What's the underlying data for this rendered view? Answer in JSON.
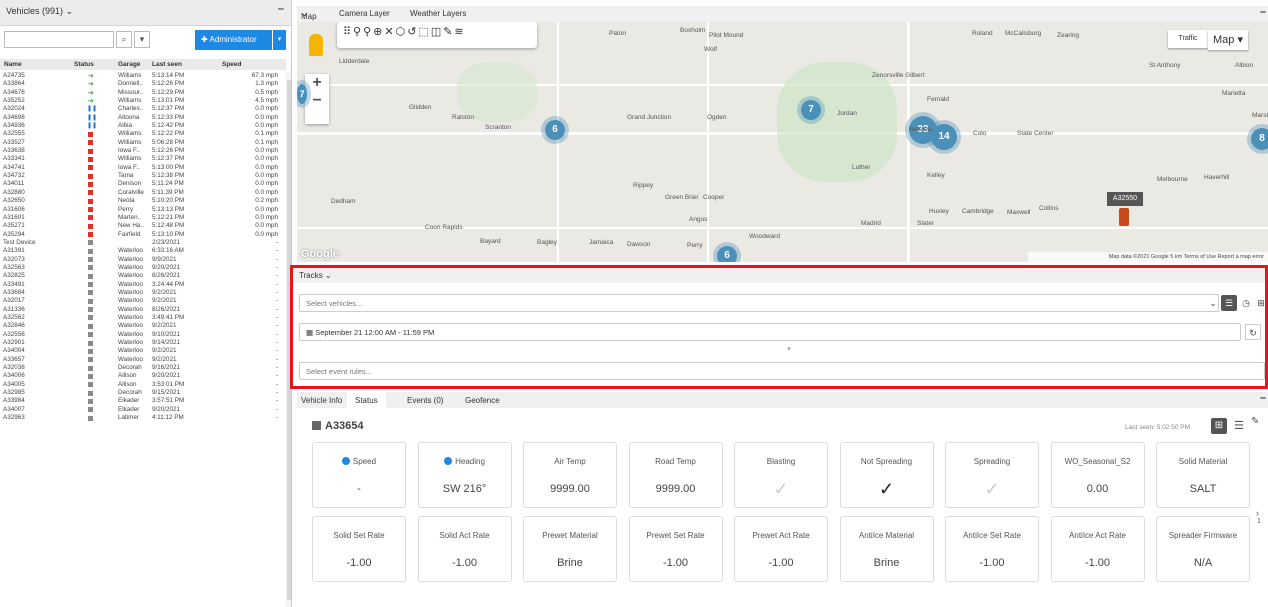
{
  "left_panel": {
    "title": "Vehicles (991)",
    "search_placeholder": "",
    "admin_label": "Administrator",
    "columns": [
      "Name",
      "Status",
      "Garage",
      "Last seen",
      "Speed"
    ],
    "rows": [
      {
        "name": "A24735",
        "status": "green",
        "garage": "Williams",
        "last_seen": "5:13:14 PM",
        "speed": "67.3 mph"
      },
      {
        "name": "A33864",
        "status": "green",
        "garage": "Donnell..",
        "last_seen": "5:12:26 PM",
        "speed": "1.3 mph"
      },
      {
        "name": "A34676",
        "status": "green",
        "garage": "Missour..",
        "last_seen": "5:12:29 PM",
        "speed": "0.5 mph"
      },
      {
        "name": "A35252",
        "status": "green",
        "garage": "Williams",
        "last_seen": "5:13:01 PM",
        "speed": "4.5 mph"
      },
      {
        "name": "A32024",
        "status": "blue",
        "garage": "Charles..",
        "last_seen": "5:12:37 PM",
        "speed": "0.0 mph"
      },
      {
        "name": "A34698",
        "status": "blue",
        "garage": "Altoona",
        "last_seen": "5:12:33 PM",
        "speed": "0.0 mph"
      },
      {
        "name": "A34936",
        "status": "blue",
        "garage": "Albia",
        "last_seen": "5:12:42 PM",
        "speed": "0.0 mph"
      },
      {
        "name": "A32555",
        "status": "red",
        "garage": "Williams",
        "last_seen": "5:12:22 PM",
        "speed": "0.1 mph"
      },
      {
        "name": "A33527",
        "status": "red",
        "garage": "Williams",
        "last_seen": "5:06:28 PM",
        "speed": "0.1 mph"
      },
      {
        "name": "A33638",
        "status": "red",
        "garage": "Iowa F..",
        "last_seen": "5:12:26 PM",
        "speed": "0.0 mph"
      },
      {
        "name": "A33341",
        "status": "red",
        "garage": "Williams",
        "last_seen": "5:12:37 PM",
        "speed": "0.0 mph"
      },
      {
        "name": "A34741",
        "status": "red",
        "garage": "Iowa F..",
        "last_seen": "5:13:00 PM",
        "speed": "0.0 mph"
      },
      {
        "name": "A34732",
        "status": "red",
        "garage": "Tama",
        "last_seen": "5:12:38 PM",
        "speed": "0.0 mph"
      },
      {
        "name": "A34011",
        "status": "red",
        "garage": "Denison",
        "last_seen": "5:11:24 PM",
        "speed": "0.0 mph"
      },
      {
        "name": "A32880",
        "status": "red",
        "garage": "Coralville",
        "last_seen": "5:11:39 PM",
        "speed": "0.0 mph"
      },
      {
        "name": "A32650",
        "status": "red",
        "garage": "Neola",
        "last_seen": "5:10:20 PM",
        "speed": "0.2 mph"
      },
      {
        "name": "A31606",
        "status": "red",
        "garage": "Perry",
        "last_seen": "5:13:13 PM",
        "speed": "0.0 mph"
      },
      {
        "name": "A31601",
        "status": "red",
        "garage": "Marten..",
        "last_seen": "5:12:21 PM",
        "speed": "0.0 mph"
      },
      {
        "name": "A35271",
        "status": "red",
        "garage": "New Ha..",
        "last_seen": "5:12:48 PM",
        "speed": "0.0 mph"
      },
      {
        "name": "A35294",
        "status": "red",
        "garage": "Fairfield",
        "last_seen": "5:13:10 PM",
        "speed": "0.0 mph"
      },
      {
        "name": "Test Device",
        "status": "gray",
        "garage": "",
        "last_seen": "2/23/2021",
        "speed": "-"
      },
      {
        "name": "A31391",
        "status": "gray",
        "garage": "Waterloo",
        "last_seen": "6:33:16 AM",
        "speed": "-"
      },
      {
        "name": "A32073",
        "status": "gray",
        "garage": "Waterloo",
        "last_seen": "9/9/2021",
        "speed": "-"
      },
      {
        "name": "A32563",
        "status": "gray",
        "garage": "Waterloo",
        "last_seen": "9/20/2021",
        "speed": "-"
      },
      {
        "name": "A32825",
        "status": "gray",
        "garage": "Waterloo",
        "last_seen": "8/26/2021",
        "speed": "-"
      },
      {
        "name": "A33491",
        "status": "gray",
        "garage": "Waterloo",
        "last_seen": "3:24:44 PM",
        "speed": "-"
      },
      {
        "name": "A33684",
        "status": "gray",
        "garage": "Waterloo",
        "last_seen": "9/2/2021",
        "speed": "-"
      },
      {
        "name": "A32017",
        "status": "gray",
        "garage": "Waterloo",
        "last_seen": "9/2/2021",
        "speed": "-"
      },
      {
        "name": "A31336",
        "status": "gray",
        "garage": "Waterloo",
        "last_seen": "8/26/2021",
        "speed": "-"
      },
      {
        "name": "A32562",
        "status": "gray",
        "garage": "Waterloo",
        "last_seen": "3:49:41 PM",
        "speed": "-"
      },
      {
        "name": "A32846",
        "status": "gray",
        "garage": "Waterloo",
        "last_seen": "9/2/2021",
        "speed": "-"
      },
      {
        "name": "A32556",
        "status": "gray",
        "garage": "Waterloo",
        "last_seen": "9/10/2021",
        "speed": "-"
      },
      {
        "name": "A32901",
        "status": "gray",
        "garage": "Waterloo",
        "last_seen": "9/14/2021",
        "speed": "-"
      },
      {
        "name": "A34004",
        "status": "gray",
        "garage": "Waterloo",
        "last_seen": "9/2/2021",
        "speed": "-"
      },
      {
        "name": "A33657",
        "status": "gray",
        "garage": "Waterloo",
        "last_seen": "9/2/2021",
        "speed": "-"
      },
      {
        "name": "A32038",
        "status": "gray",
        "garage": "Decorah",
        "last_seen": "9/16/2021",
        "speed": "-"
      },
      {
        "name": "A34006",
        "status": "gray",
        "garage": "Allison",
        "last_seen": "9/20/2021",
        "speed": "-"
      },
      {
        "name": "A34005",
        "status": "gray",
        "garage": "Allison",
        "last_seen": "3:53:01 PM",
        "speed": "-"
      },
      {
        "name": "A32985",
        "status": "gray",
        "garage": "Decorah",
        "last_seen": "9/15/2021",
        "speed": "-"
      },
      {
        "name": "A33984",
        "status": "gray",
        "garage": "Elkader",
        "last_seen": "3:57:51 PM",
        "speed": "-"
      },
      {
        "name": "A34007",
        "status": "gray",
        "garage": "Elkader",
        "last_seen": "9/20/2021",
        "speed": "-"
      },
      {
        "name": "A32963",
        "status": "gray",
        "garage": "Latimer",
        "last_seen": "4:11:12 PM",
        "speed": "-"
      }
    ]
  },
  "map": {
    "tab_label": "Map",
    "layers": [
      "Camera Layer",
      "Weather Layers"
    ],
    "traffic_label": "Traffic",
    "maptype_label": "Map",
    "attribution": "Map data ©2021 Google   5 km   Terms of Use   Report a map error",
    "google": "Google",
    "vehicle_label": "A32550",
    "clusters": [
      "6",
      "7",
      "33",
      "14",
      "8",
      "6",
      "7"
    ],
    "place_labels": [
      "Paton",
      "Boxholm",
      "Pilot Mound",
      "Wolf",
      "Roland",
      "McCallsburg",
      "Zearing",
      "St Anthony",
      "Albion",
      "Lidderdale",
      "Glidden",
      "Ralston",
      "Scranton",
      "Grand Junction",
      "Ogden",
      "Jordan",
      "Zenorsville Gilbert",
      "Fernald",
      "Marietta",
      "Nevada",
      "Colo",
      "State Center",
      "Luther",
      "Kelley",
      "Melbourne",
      "Haverhill",
      "Rippey",
      "Green Brier",
      "Cooper",
      "Dedham",
      "Huxley",
      "Cambridge",
      "Maxwell",
      "Collins",
      "Angus",
      "Madrid",
      "Slater",
      "Coon Rapids",
      "Bayard",
      "Bagley",
      "Jamaica",
      "Dawson",
      "Perry",
      "Woodward",
      "Marshalltown"
    ]
  },
  "tracks": {
    "title": "Tracks",
    "vehicles_placeholder": "Select vehicles...",
    "date_range": "September 21 12:00 AM - 11:59 PM",
    "events_placeholder": "Select event rules..."
  },
  "details": {
    "tabs": [
      "Vehicle Info",
      "Status",
      "Events (0)",
      "Geofence"
    ],
    "active_tab": "Status",
    "vehicle_id": "A33654",
    "last_seen": "Last seen: 5:02:50 PM",
    "cards_row1": [
      {
        "title": "Speed",
        "value": "-",
        "icon": "speed-icon"
      },
      {
        "title": "Heading",
        "value": "SW 216°",
        "icon": "heading-icon"
      },
      {
        "title": "Air Temp",
        "value": "9999.00"
      },
      {
        "title": "Road Temp",
        "value": "9999.00"
      },
      {
        "title": "Blasting",
        "value": "✓",
        "check": "off"
      },
      {
        "title": "Not Spreading",
        "value": "✓",
        "check": "on"
      },
      {
        "title": "Spreading",
        "value": "✓",
        "check": "off"
      },
      {
        "title": "WO_Seasonal_S2",
        "value": "0.00"
      },
      {
        "title": "Solid Material",
        "value": "SALT"
      }
    ],
    "cards_row2": [
      {
        "title": "Solid Set Rate",
        "value": "-1.00"
      },
      {
        "title": "Solid Act Rate",
        "value": "-1.00"
      },
      {
        "title": "Prewet Material",
        "value": "Brine"
      },
      {
        "title": "Prewet Set Rate",
        "value": "-1.00"
      },
      {
        "title": "Prewet Act Rate",
        "value": "-1.00"
      },
      {
        "title": "AntiIce Material",
        "value": "Brine"
      },
      {
        "title": "AntiIce Set Rate",
        "value": "-1.00"
      },
      {
        "title": "AntiIce Act Rate",
        "value": "-1.00"
      },
      {
        "title": "Spreader Firmware",
        "value": "N/A"
      }
    ],
    "pager_label": "1"
  },
  "colors": {
    "accent": "#1e88e5",
    "green": "#3aa83a",
    "blue": "#1e73d8",
    "red": "#e0302a",
    "gray": "#8a8a8a",
    "highlight": "#e0181c",
    "cluster": "#4a90b8"
  }
}
